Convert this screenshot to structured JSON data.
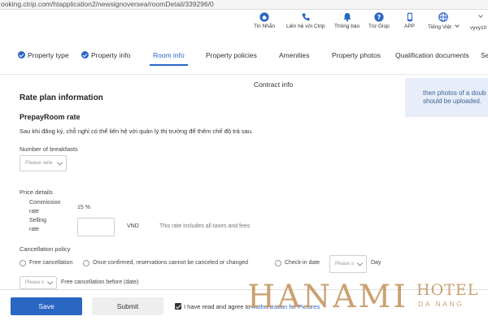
{
  "browser": {
    "url": "ooking.ctrip.com/htapplication2/newsignoversea/roomDetail/339296/0"
  },
  "topbar": {
    "items": [
      {
        "label": "Tin Nhắn",
        "icon": "home-icon"
      },
      {
        "label": "Liên hệ với Ctrip",
        "icon": "phone-icon"
      },
      {
        "label": "Thông báo",
        "icon": "bell-icon"
      },
      {
        "label": "Trợ Giúp",
        "icon": "help-icon"
      },
      {
        "label": "APP",
        "icon": "app-icon"
      },
      {
        "label": "Tiếng Việt",
        "icon": "globe-icon"
      },
      {
        "label": "vyvy10",
        "icon": "user-menu"
      }
    ]
  },
  "tabs": [
    {
      "label": "Property type",
      "checked": true
    },
    {
      "label": "Property info",
      "checked": true
    },
    {
      "label": "Room info",
      "active": true
    },
    {
      "label": "Property policies"
    },
    {
      "label": "Amenities"
    },
    {
      "label": "Property photos"
    },
    {
      "label": "Qualification documents"
    },
    {
      "label": "Se"
    },
    {
      "label": "Contract info"
    }
  ],
  "side_note": {
    "line1": "then photos of a doub",
    "line2": "should be uploaded."
  },
  "rate_plan": {
    "title": "Rate plan information",
    "subtitle": "PrepayRoom rate",
    "description": "Sau khi đăng ký, chỗ nghỉ có thể liên hệ với quản lý thị trường để thêm chế độ trả sau.",
    "breakfast_label": "Number of breakfasts",
    "breakfast_placeholder": "Please sele"
  },
  "price": {
    "label": "Price details",
    "commission_line1": "Commission",
    "commission_line2": "rate",
    "commission_value": "15 %",
    "selling_line1": "Selling",
    "selling_line2": "rate",
    "currency": "VND",
    "note": "This rate includes all taxes and fees"
  },
  "cancellation": {
    "label": "Cancellation policy",
    "options": [
      "Free cancellation",
      "Once confirmed, reservations cannot be canceled or changed",
      "Check-in date"
    ],
    "checkin_select": "Please s",
    "day_label": "Day",
    "before_select": "Please s",
    "before_label": "Free cancellation before (date)"
  },
  "footer": {
    "save": "Save",
    "submit": "Submit",
    "agree_text": "I have read and agree to",
    "agree_link": "Authorization for Pictures"
  },
  "watermark": {
    "main": "HANAMI",
    "hotel": "HOTEL",
    "city": "DA NANG"
  },
  "colors": {
    "accent": "#2a66c4",
    "watermark": "#c69a66",
    "note_bg": "#e7eef9"
  }
}
